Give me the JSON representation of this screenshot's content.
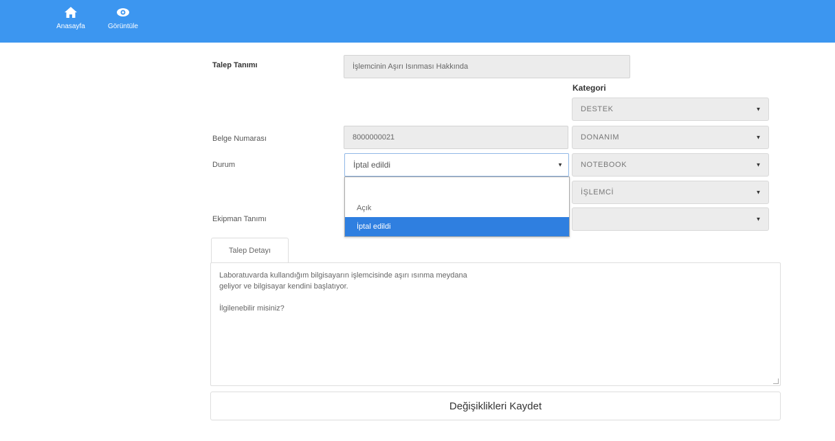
{
  "nav": {
    "items": [
      {
        "label": "Anasayfa",
        "icon": "home-icon"
      },
      {
        "label": "Görüntüle",
        "icon": "eye-icon"
      }
    ]
  },
  "form": {
    "talep_tanimi": {
      "label": "Talep Tanımı",
      "value": "İşlemcinin Aşırı Isınması Hakkında"
    },
    "kategori": {
      "label": "Kategori",
      "selects": [
        "DESTEK",
        "DONANIM",
        "NOTEBOOK",
        "İŞLEMCİ",
        ""
      ]
    },
    "belge_numarasi": {
      "label": "Belge Numarası",
      "value": "8000000021"
    },
    "durum": {
      "label": "Durum",
      "selected": "İptal edildi",
      "options": [
        "",
        "Açık",
        "İptal edildi"
      ]
    },
    "ekipman_tanimi": {
      "label": "Ekipman Tanımı"
    },
    "tab": {
      "label": "Talep Detayı"
    },
    "detail_text": "Laboratuvarda kullandığım bilgisayarın işlemcisinde aşırı ısınma meydana\ngeliyor ve bilgisayar kendini başlatıyor.\n\nİlgilenebilir misiniz?",
    "save_label": "Değişiklikleri Kaydet"
  },
  "colors": {
    "accent": "#3c96f0",
    "highlight": "#2f7fe0"
  }
}
